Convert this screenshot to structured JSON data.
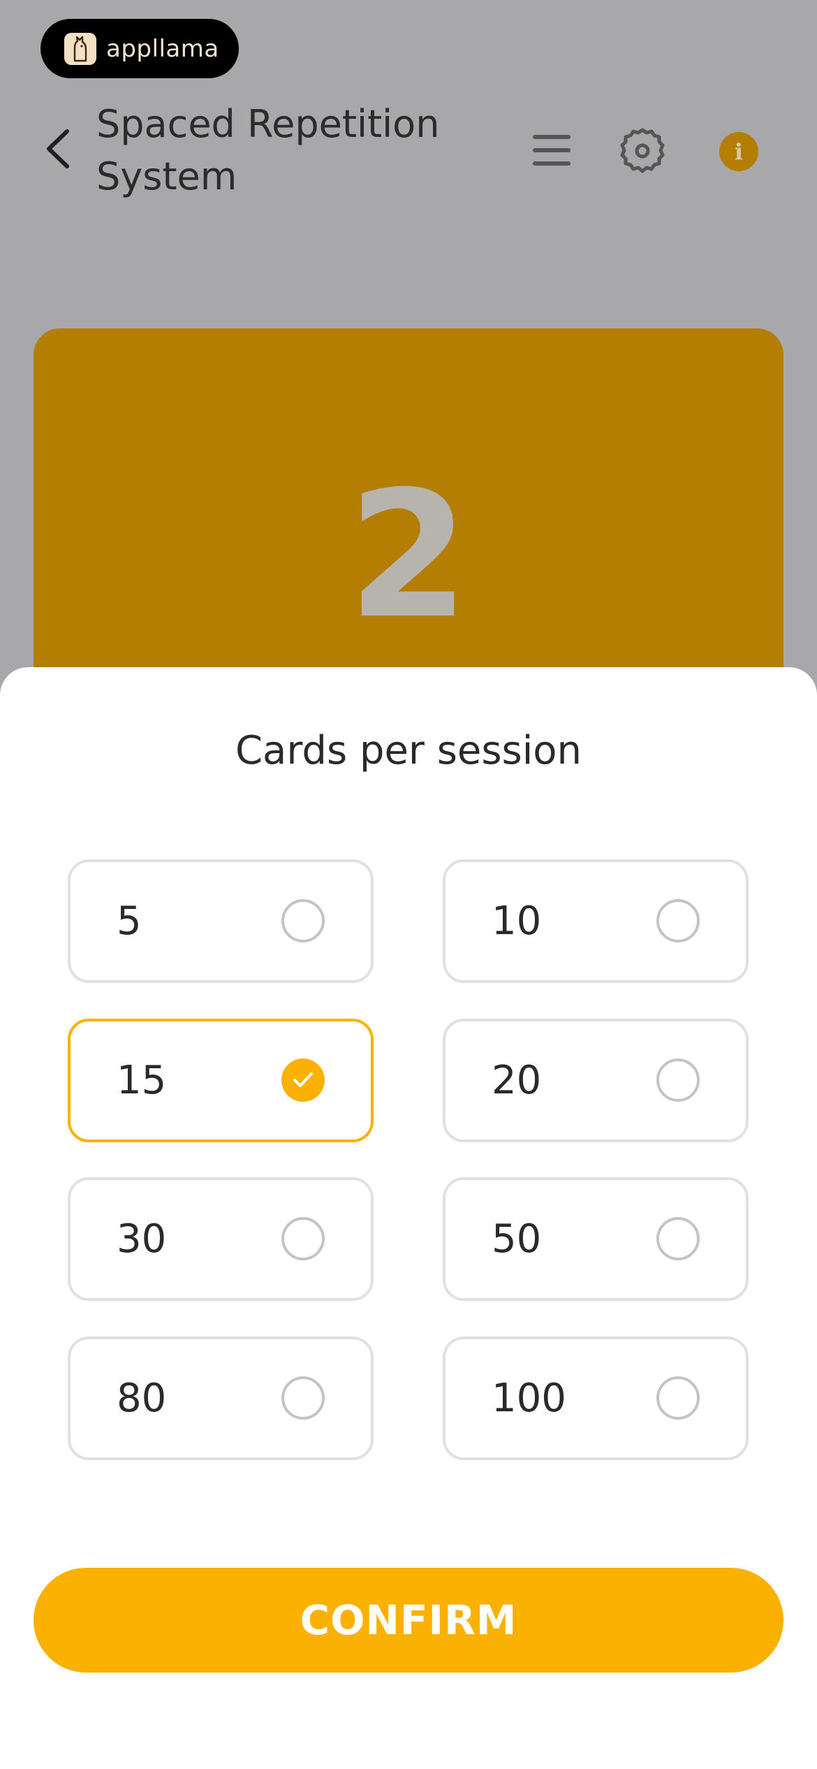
{
  "app": {
    "logo_text": "appllama",
    "logo_icon": "llama-icon"
  },
  "header": {
    "title": "Spaced Repetition System",
    "back_icon": "chevron-left-icon",
    "menu_icon": "menu-icon",
    "settings_icon": "gear-icon",
    "info_icon": "info-icon",
    "info_glyph": "i"
  },
  "deck": {
    "count": "2"
  },
  "colors": {
    "accent": "#fbb102",
    "accent_dimmed": "#b47e02",
    "overlay_gray": "#a8a8aa"
  },
  "sheet": {
    "title": "Cards per session",
    "options": [
      {
        "label": "5",
        "selected": false
      },
      {
        "label": "10",
        "selected": false
      },
      {
        "label": "15",
        "selected": true
      },
      {
        "label": "20",
        "selected": false
      },
      {
        "label": "30",
        "selected": false
      },
      {
        "label": "50",
        "selected": false
      },
      {
        "label": "80",
        "selected": false
      },
      {
        "label": "100",
        "selected": false
      }
    ],
    "confirm_label": "CONFIRM"
  }
}
